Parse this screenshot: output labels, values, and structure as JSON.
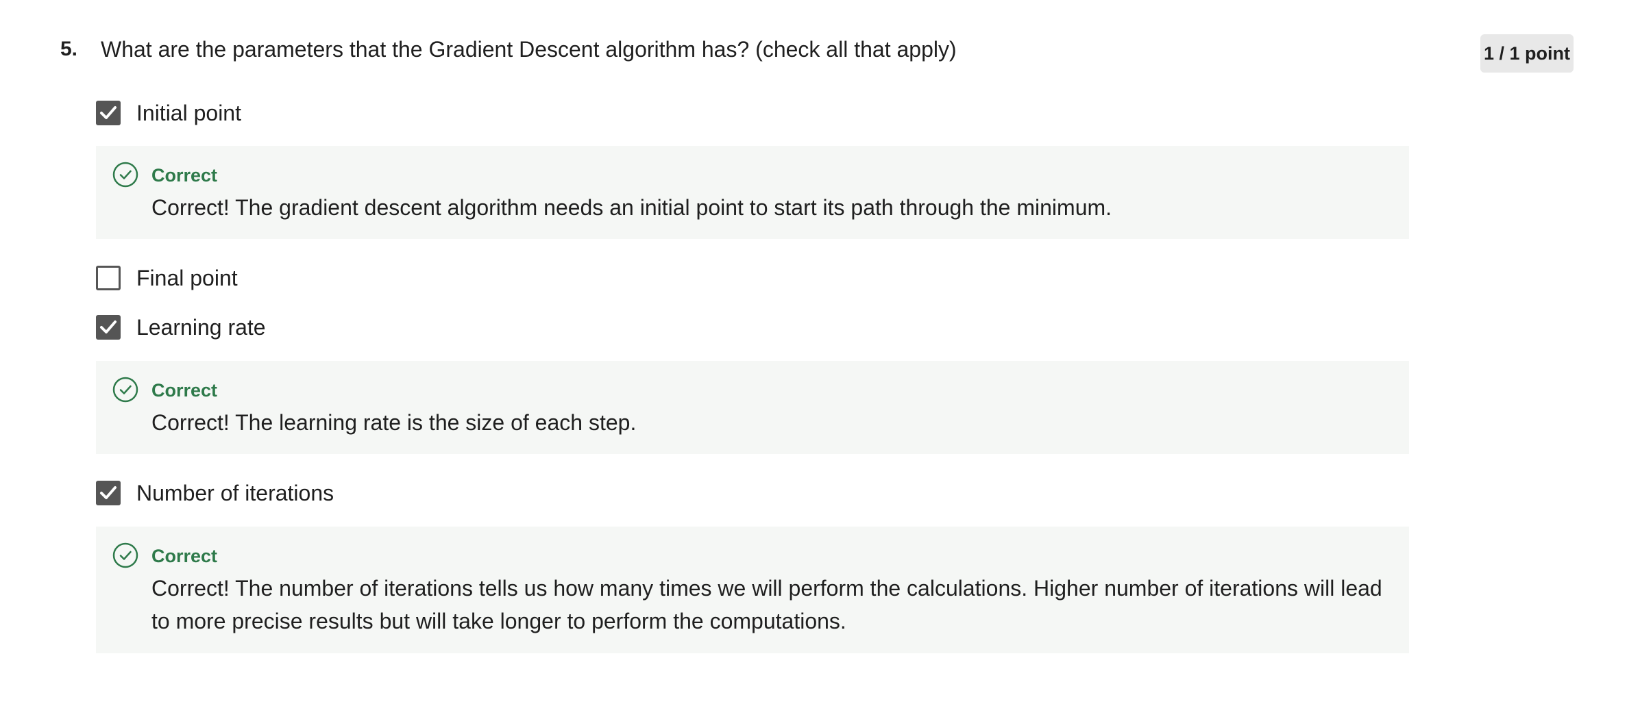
{
  "question": {
    "number": "5.",
    "text": "What are the parameters that the Gradient Descent algorithm has? (check all that apply)",
    "score": "1 / 1 point"
  },
  "options": [
    {
      "label": "Initial point",
      "checked": true,
      "feedback": {
        "title": "Correct",
        "text": "Correct! The gradient descent algorithm needs an initial point to start its path through the minimum."
      }
    },
    {
      "label": "Final point",
      "checked": false
    },
    {
      "label": "Learning rate",
      "checked": true,
      "feedback": {
        "title": "Correct",
        "text": "Correct! The learning rate is the size of each step."
      }
    },
    {
      "label": "Number of iterations",
      "checked": true,
      "feedback": {
        "title": "Correct",
        "text": "Correct! The number of iterations tells us how many times we will perform the calculations. Higher number of iterations will lead to more precise results but will take longer to perform the computations."
      }
    }
  ],
  "icons": {
    "checkbox_checked": "check-icon",
    "feedback": "check-circle-icon"
  },
  "colors": {
    "correct": "#2e7a4a",
    "feedback_bg": "#f5f7f5",
    "checkbox": "#555555",
    "badge_bg": "#e8e8e8"
  }
}
